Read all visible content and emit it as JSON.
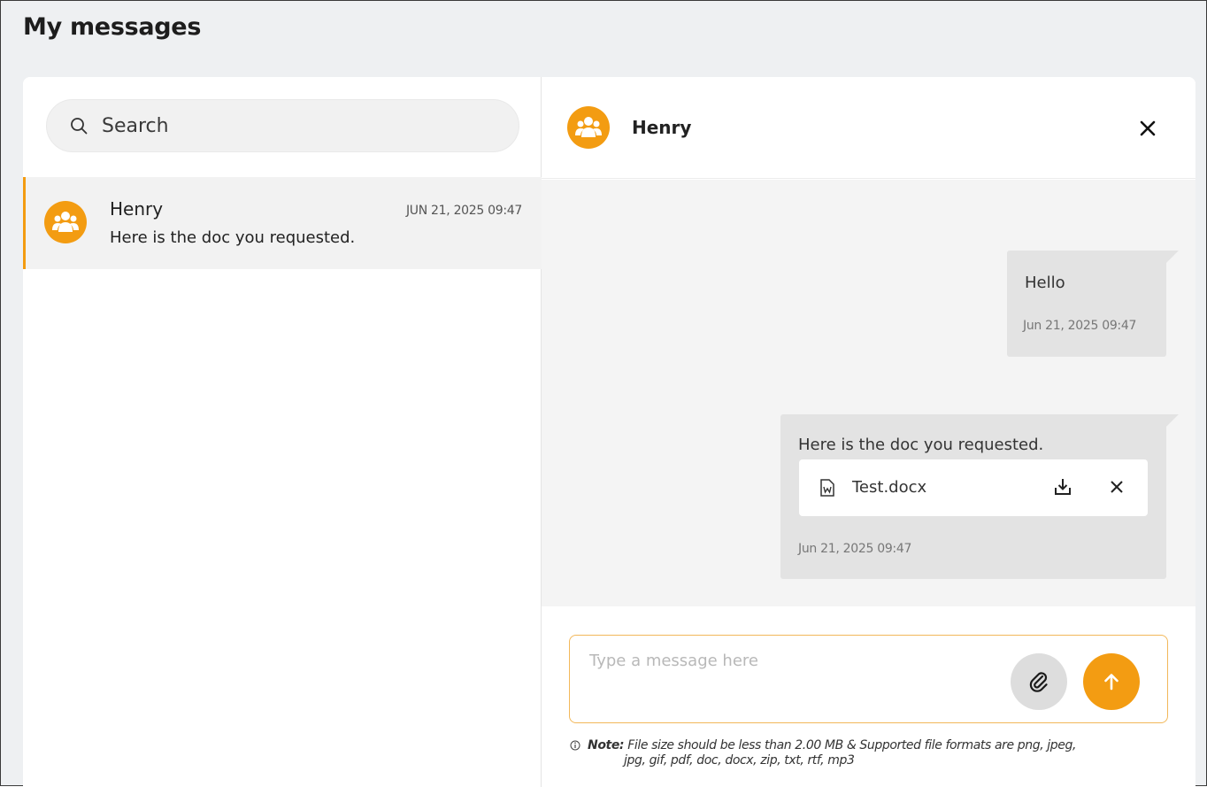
{
  "page": {
    "title": "My messages"
  },
  "search": {
    "placeholder": "Search"
  },
  "conversations": [
    {
      "name": "Henry",
      "time": "JUN 21, 2025 09:47",
      "preview": "Here is the doc you requested."
    }
  ],
  "chat": {
    "contact_name": "Henry",
    "messages": [
      {
        "text": "Hello",
        "time": "Jun 21, 2025 09:47"
      },
      {
        "text": "Here is the doc you requested.",
        "time": "Jun 21, 2025 09:47",
        "attachment": {
          "file_name": "Test.docx"
        }
      }
    ],
    "composer": {
      "placeholder": "Type a message here"
    },
    "note": {
      "label": "Note:",
      "line1": "File size should be less than 2.00 MB & Supported file formats are png, jpeg,",
      "line2": "jpg, gif, pdf, doc, docx, zip, txt, rtf, mp3"
    }
  },
  "colors": {
    "accent": "#f39c12",
    "bubble": "#e3e3e3",
    "chat_bg": "#f4f4f4",
    "page_bg": "#eef0f2"
  },
  "icons": [
    "search-icon",
    "user-group-icon",
    "close-icon",
    "word-file-icon",
    "download-icon",
    "paperclip-icon",
    "arrow-up-icon",
    "info-icon"
  ]
}
